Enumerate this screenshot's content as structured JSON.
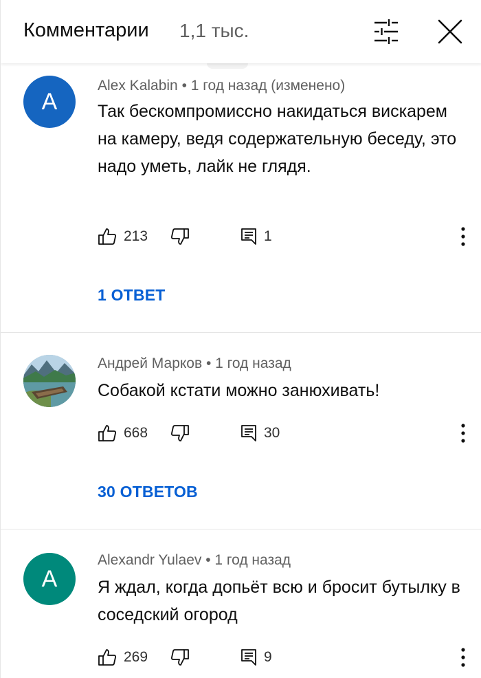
{
  "header": {
    "title": "Комментарии",
    "count": "1,1 тыс."
  },
  "colors": {
    "link": "#065fd4",
    "avatar_1": "#1565c0",
    "avatar_3": "#00897b",
    "notification": "#e00000"
  },
  "icons": {
    "filter": "filter-sliders-icon",
    "close": "close-x-icon",
    "like": "thumb-up-icon",
    "dislike": "thumb-down-icon",
    "reply": "reply-comment-icon",
    "more": "vertical-ellipsis-icon"
  },
  "comments": [
    {
      "avatar_letter": "A",
      "meta": "Alex Kalabin • 1 год назад (изменено)",
      "text": "Так бескомпромиссно накидаться вискарем на камеру, ведя содержательную беседу, это надо уметь, лайк не глядя.",
      "likes": "213",
      "replies_count": "1",
      "replies_label": "1 ОТВЕТ"
    },
    {
      "avatar_letter": "",
      "meta": "Андрей Марков • 1 год назад",
      "text": "Собакой кстати можно занюхивать!",
      "likes": "668",
      "replies_count": "30",
      "replies_label": "30 ОТВЕТОВ"
    },
    {
      "avatar_letter": "A",
      "meta": "Alexandr Yulaev • 1 год назад",
      "text": "Я ждал, когда допьёт всю и бросит бутылку в соседский огород",
      "likes": "269",
      "replies_count": "9"
    }
  ]
}
